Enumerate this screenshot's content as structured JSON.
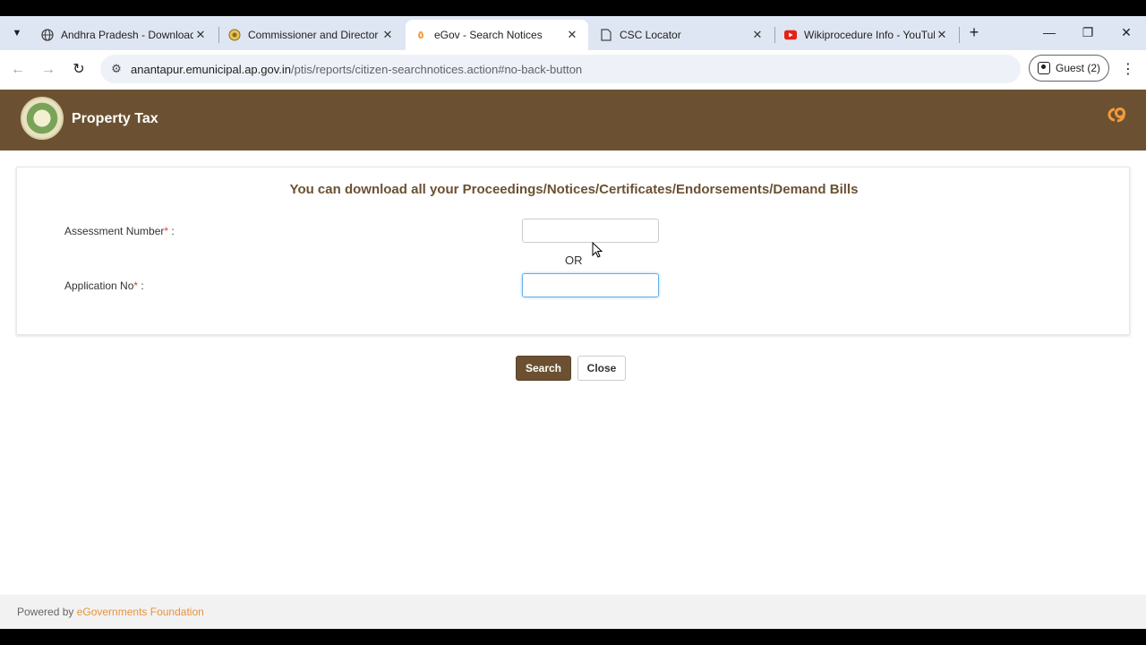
{
  "browser": {
    "tabs": [
      {
        "title": "Andhra Pradesh - Download",
        "favicon": "globe-icon",
        "active": false
      },
      {
        "title": "Commissioner and Director o",
        "favicon": "emblem-icon",
        "active": false
      },
      {
        "title": "eGov - Search Notices",
        "favicon": "egov-icon",
        "active": true
      },
      {
        "title": "CSC Locator",
        "favicon": "page-icon",
        "active": false
      },
      {
        "title": "Wikiprocedure Info - YouTub",
        "favicon": "youtube-icon",
        "active": false
      }
    ],
    "url_host": "anantapur.emunicipal.ap.gov.in",
    "url_path": "/ptis/reports/citizen-searchnotices.action#no-back-button",
    "profile_label": "Guest (2)"
  },
  "app": {
    "title": "Property Tax"
  },
  "form": {
    "heading": "You can download all your Proceedings/Notices/Certificates/Endorsements/Demand Bills",
    "assessment_label": "Assessment Number",
    "assessment_suffix": " :",
    "assessment_value": "",
    "or_text": "OR",
    "application_label": "Application No",
    "application_suffix": " :",
    "application_value": "",
    "required_mark": "*"
  },
  "actions": {
    "search_label": "Search",
    "close_label": "Close"
  },
  "footer": {
    "powered_by": "Powered by ",
    "org": "eGovernments Foundation"
  },
  "colors": {
    "brand": "#6b5132",
    "accent": "#e8923a",
    "required": "#e53935"
  }
}
